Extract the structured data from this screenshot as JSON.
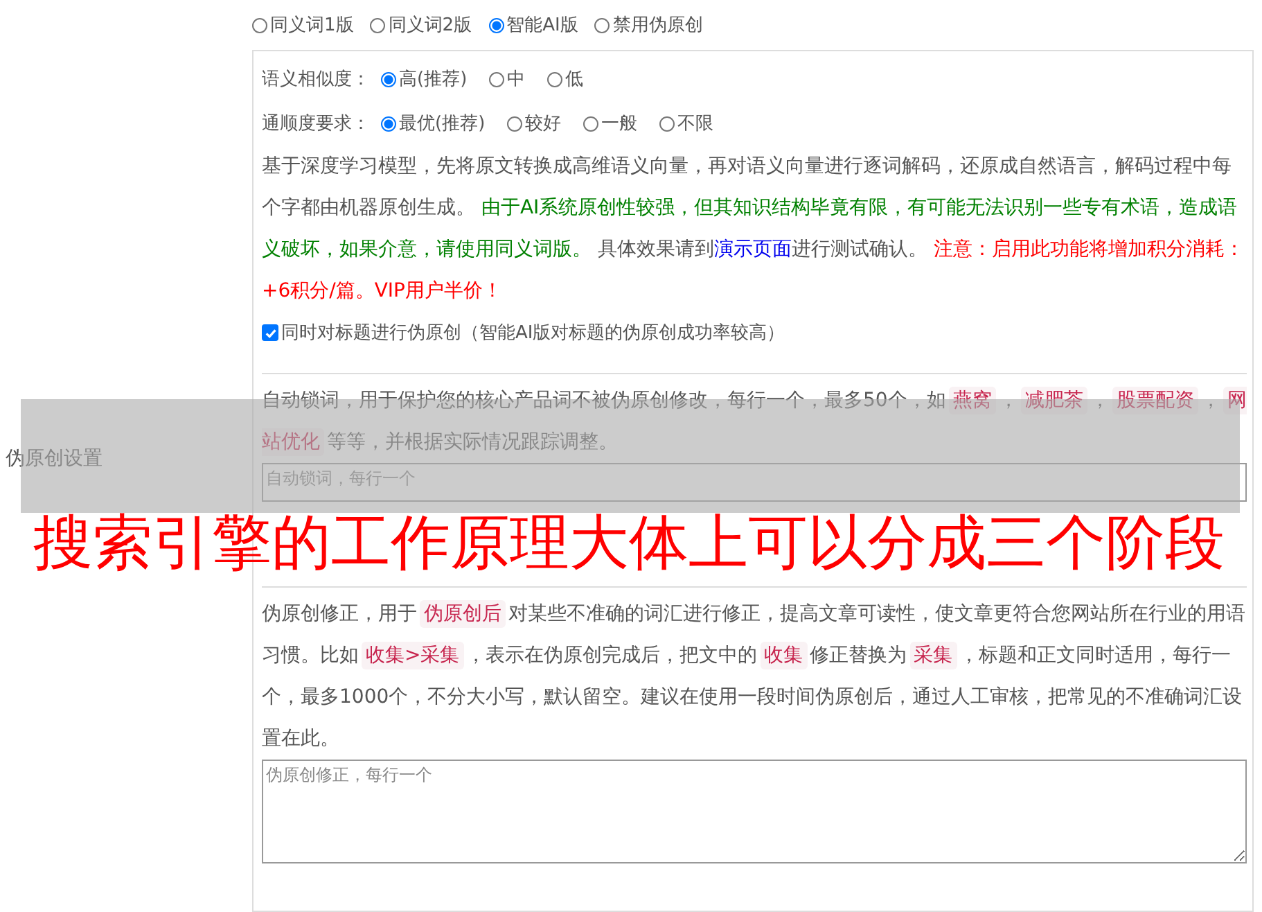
{
  "setting_label": "伪原创设置",
  "modes": [
    {
      "label": "同义词1版",
      "selected": false
    },
    {
      "label": "同义词2版",
      "selected": false
    },
    {
      "label": "智能AI版",
      "selected": true
    },
    {
      "label": "禁用伪原创",
      "selected": false
    }
  ],
  "similarity": {
    "label": "语义相似度：",
    "options": [
      {
        "label": "高(推荐)",
        "selected": true
      },
      {
        "label": "中",
        "selected": false
      },
      {
        "label": "低",
        "selected": false
      }
    ]
  },
  "fluency": {
    "label": "通顺度要求：",
    "options": [
      {
        "label": "最优(推荐)",
        "selected": true
      },
      {
        "label": "较好",
        "selected": false
      },
      {
        "label": "一般",
        "selected": false
      },
      {
        "label": "不限",
        "selected": false
      }
    ]
  },
  "ai_description": [
    {
      "kind": "text",
      "text": "基于深度学习模型，先将原文转换成高维语义向量，再对语义向量进行逐词解码，还原成自然语言，解码过程中每个字都由机器原创生成。 "
    },
    {
      "kind": "notice",
      "text": "由于AI系统原创性较强，但其知识结构毕竟有限，有可能无法识别一些专有术语，造成语义破坏，如果介意，请使用同义词版。"
    },
    {
      "kind": "text",
      "text": " 具体效果请到"
    },
    {
      "kind": "link",
      "text": "演示页面"
    },
    {
      "kind": "text",
      "text": "进行测试确认。 "
    },
    {
      "kind": "warning",
      "text": "注意：启用此功能将增加积分消耗：+6积分/篇。VIP用户半价！"
    }
  ],
  "title_option": {
    "label": "同时对标题进行伪原创（智能AI版对标题的伪原创成功率较高）",
    "checked": true
  },
  "lock_words": {
    "description": [
      {
        "kind": "text",
        "text": "自动锁词，用于保护您的核心产品词不被伪原创修改，每行一个，最多50个，如"
      },
      {
        "kind": "code",
        "text": "燕窝"
      },
      {
        "kind": "text",
        "text": "，"
      },
      {
        "kind": "code",
        "text": "减肥茶"
      },
      {
        "kind": "text",
        "text": "，"
      },
      {
        "kind": "code",
        "text": "股票配资"
      },
      {
        "kind": "text",
        "text": "，"
      },
      {
        "kind": "code",
        "text": "网站优化"
      },
      {
        "kind": "text",
        "text": "等等，并根据实际情况跟踪调整。"
      }
    ],
    "placeholder": "自动锁词，每行一个"
  },
  "corrections": {
    "description": [
      {
        "kind": "text",
        "text": "伪原创修正，用于"
      },
      {
        "kind": "code",
        "text": "伪原创后"
      },
      {
        "kind": "text",
        "text": "对某些不准确的词汇进行修正，提高文章可读性，使文章更符合您网站所在行业的用语习惯。比如"
      },
      {
        "kind": "code",
        "text": "收集>采集"
      },
      {
        "kind": "text",
        "text": "，表示在伪原创完成后，把文中的"
      },
      {
        "kind": "code",
        "text": "收集"
      },
      {
        "kind": "text",
        "text": "修正替换为"
      },
      {
        "kind": "code",
        "text": "采集"
      },
      {
        "kind": "text",
        "text": "，标题和正文同时适用，每行一个，最多1000个，不分大小写，默认留空。建议在使用一段时间伪原创后，通过人工审核，把常见的不准确词汇设置在此。"
      }
    ],
    "placeholder": "伪原创修正，每行一个"
  },
  "overlay_caption": {
    "text": "搜索引擎的工作原理大体上可以分成三个阶段"
  }
}
